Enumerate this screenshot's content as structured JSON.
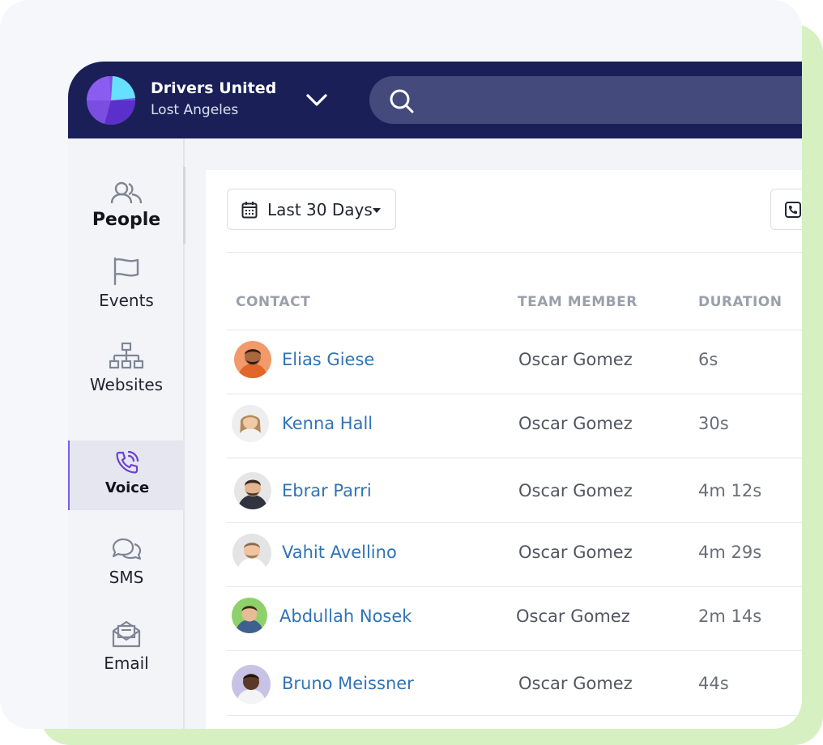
{
  "org": {
    "name": "Drivers United",
    "city": "Lost Angeles"
  },
  "search": {
    "placeholder": ""
  },
  "sidebar": {
    "items": [
      {
        "label": "People",
        "icon": "people-icon"
      },
      {
        "label": "Events",
        "icon": "flag-icon"
      },
      {
        "label": "Websites",
        "icon": "sitemap-icon"
      },
      {
        "label": "Voice",
        "icon": "phone-call-icon",
        "active": true
      },
      {
        "label": "SMS",
        "icon": "chat-bubbles-icon"
      },
      {
        "label": "Email",
        "icon": "envelope-icon"
      }
    ]
  },
  "filters": {
    "date_range": "Last 30 Days"
  },
  "table": {
    "columns": [
      "CONTACT",
      "TEAM MEMBER",
      "DURATION"
    ],
    "rows": [
      {
        "contact": "Elias Giese",
        "team_member": "Oscar Gomez",
        "duration": "6s",
        "avatar_bg": "#f39a6a"
      },
      {
        "contact": "Kenna Hall",
        "team_member": "Oscar Gomez",
        "duration": "30s",
        "avatar_bg": "#eeeeee"
      },
      {
        "contact": "Ebrar Parri",
        "team_member": "Oscar Gomez",
        "duration": "4m 12s",
        "avatar_bg": "#e6e6e6"
      },
      {
        "contact": "Vahit Avellino",
        "team_member": "Oscar Gomez",
        "duration": "4m 29s",
        "avatar_bg": "#e4e4e4"
      },
      {
        "contact": "Abdullah Nosek",
        "team_member": "Oscar Gomez",
        "duration": "2m 14s",
        "avatar_bg": "#8ed16b"
      },
      {
        "contact": "Bruno Meissner",
        "team_member": "Oscar Gomez",
        "duration": "44s",
        "avatar_bg": "#c7c3e6"
      }
    ]
  },
  "colors": {
    "topbar": "#1a2057",
    "accent": "#7b5ce4",
    "link": "#3073b5",
    "green_backdrop": "#d6f0c2"
  }
}
